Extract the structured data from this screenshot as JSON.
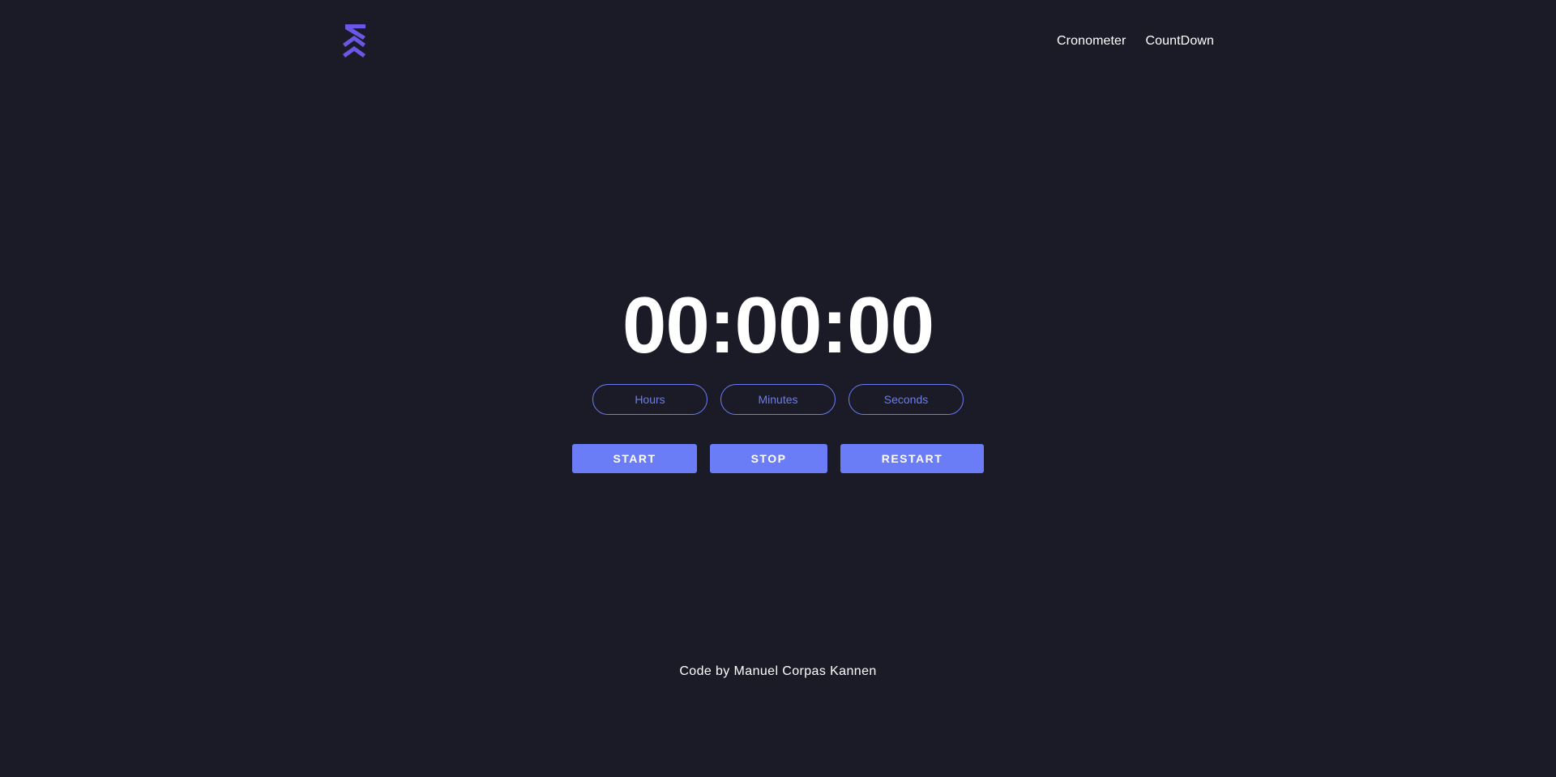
{
  "header": {
    "logo_icon": "kk-chevron-logo-icon",
    "brand_color": "#6a57e3",
    "nav": [
      {
        "label": "Cronometer"
      },
      {
        "label": "CountDown"
      }
    ]
  },
  "main": {
    "timer_display": "00:00:00",
    "inputs": [
      {
        "placeholder": "Hours",
        "value": ""
      },
      {
        "placeholder": "Minutes",
        "value": ""
      },
      {
        "placeholder": "Seconds",
        "value": ""
      }
    ],
    "buttons": {
      "start_label": "START",
      "stop_label": "STOP",
      "restart_label": "RESTART"
    },
    "accent_color": "#6b7cf7"
  },
  "footer": {
    "credit": "Code by Manuel Corpas Kannen"
  },
  "background_color": "#1b1b28"
}
